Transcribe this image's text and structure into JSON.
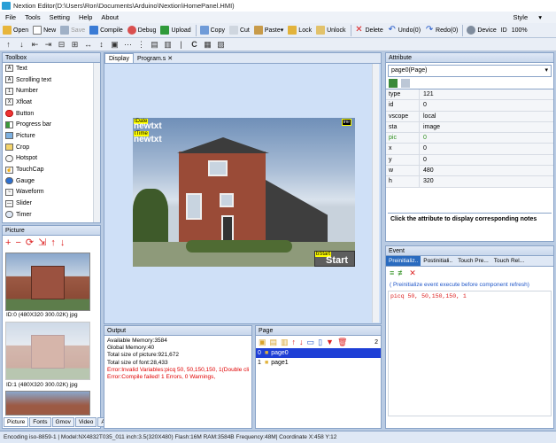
{
  "window": {
    "title": "Nextion Editor(D:\\Users\\Ron\\Documents\\Arduino\\Nextion\\HomePanel.HMI)"
  },
  "menu": {
    "items": [
      "File",
      "Tools",
      "Setting",
      "Help",
      "About"
    ],
    "style": "Style"
  },
  "toolbar": {
    "open": "Open",
    "new": "New",
    "save": "Save",
    "compile": "Compile",
    "debug": "Debug",
    "upload": "Upload",
    "copy": "Copy",
    "cut": "Cut",
    "paste": "Paste",
    "lock": "Lock",
    "unlock": "Unlock",
    "delete": "Delete",
    "undo": "Undo(0)",
    "redo": "Redo(0)",
    "device": "Device",
    "id": "ID",
    "zoom": "100%"
  },
  "toolbox": {
    "title": "Toolbox",
    "items": [
      "Text",
      "Scrolling text",
      "Number",
      "Xfloat",
      "Button",
      "Progress bar",
      "Picture",
      "Crop",
      "Hotspot",
      "TouchCap",
      "Gauge",
      "Waveform",
      "Slider",
      "Timer"
    ]
  },
  "picture_panel": {
    "title": "Picture",
    "pictures": [
      {
        "label": "ID:0  (480X320 300.02K) jpg"
      },
      {
        "label": "ID:1  (480X320 300.02K) jpg"
      }
    ],
    "tabs": [
      "Picture",
      "Fonts",
      "Gmov",
      "Video",
      "Audio"
    ]
  },
  "doc_tabs": {
    "display": "Display",
    "program": "Program.s"
  },
  "canvas": {
    "date_tag": "tDate",
    "date_text": "newtxt",
    "time_tag": "tTime",
    "time_text": "newtxt",
    "start_tag": "bStart",
    "start_text": "Start",
    "corner_tag": "tmr"
  },
  "attribute": {
    "title": "Attribute",
    "selected": "page0(Page)",
    "rows": [
      {
        "k": "type",
        "v": "121"
      },
      {
        "k": "id",
        "v": "0"
      },
      {
        "k": "vscope",
        "v": "local"
      },
      {
        "k": "sta",
        "v": "image"
      },
      {
        "k": "pic",
        "v": "0"
      },
      {
        "k": "x",
        "v": "0"
      },
      {
        "k": "y",
        "v": "0"
      },
      {
        "k": "w",
        "v": "480"
      },
      {
        "k": "h",
        "v": "320"
      }
    ],
    "note": "Click the attribute to display corresponding notes"
  },
  "event": {
    "title": "Event",
    "tabs": [
      "Preinitializ..",
      "Postinitiali..",
      "Touch Pre...",
      "Touch Rel..."
    ],
    "comment": "( Preinitialize event execute before component refresh)",
    "code": "picq 50, 50,150,150, 1"
  },
  "output": {
    "title": "Output",
    "lines": [
      {
        "text": "Available Memory:3584",
        "color": "#000000"
      },
      {
        "text": "Global Memory:40",
        "color": "#000000"
      },
      {
        "text": "Total size of picture:921,672",
        "color": "#000000"
      },
      {
        "text": "Total size of font:28,433",
        "color": "#000000"
      },
      {
        "text": "Error:Invalid Variables:picq 50, 50,150,150, 1(Double cli",
        "color": "#e00000"
      },
      {
        "text": "Error:Compile failed! 1 Errors, 0 Warnings,",
        "color": "#e00000"
      }
    ]
  },
  "page_panel": {
    "title": "Page",
    "count": "2",
    "pages": [
      {
        "index": "0",
        "name": "page0"
      },
      {
        "index": "1",
        "name": "page1"
      }
    ]
  },
  "statusbar": {
    "text": "Encoding iso-8859-1 | Model:NX4832T035_011  inch:3.5(320X480) Flash:16M RAM:3584B Frequency:48M|   Coordinate X:458  Y:12"
  }
}
